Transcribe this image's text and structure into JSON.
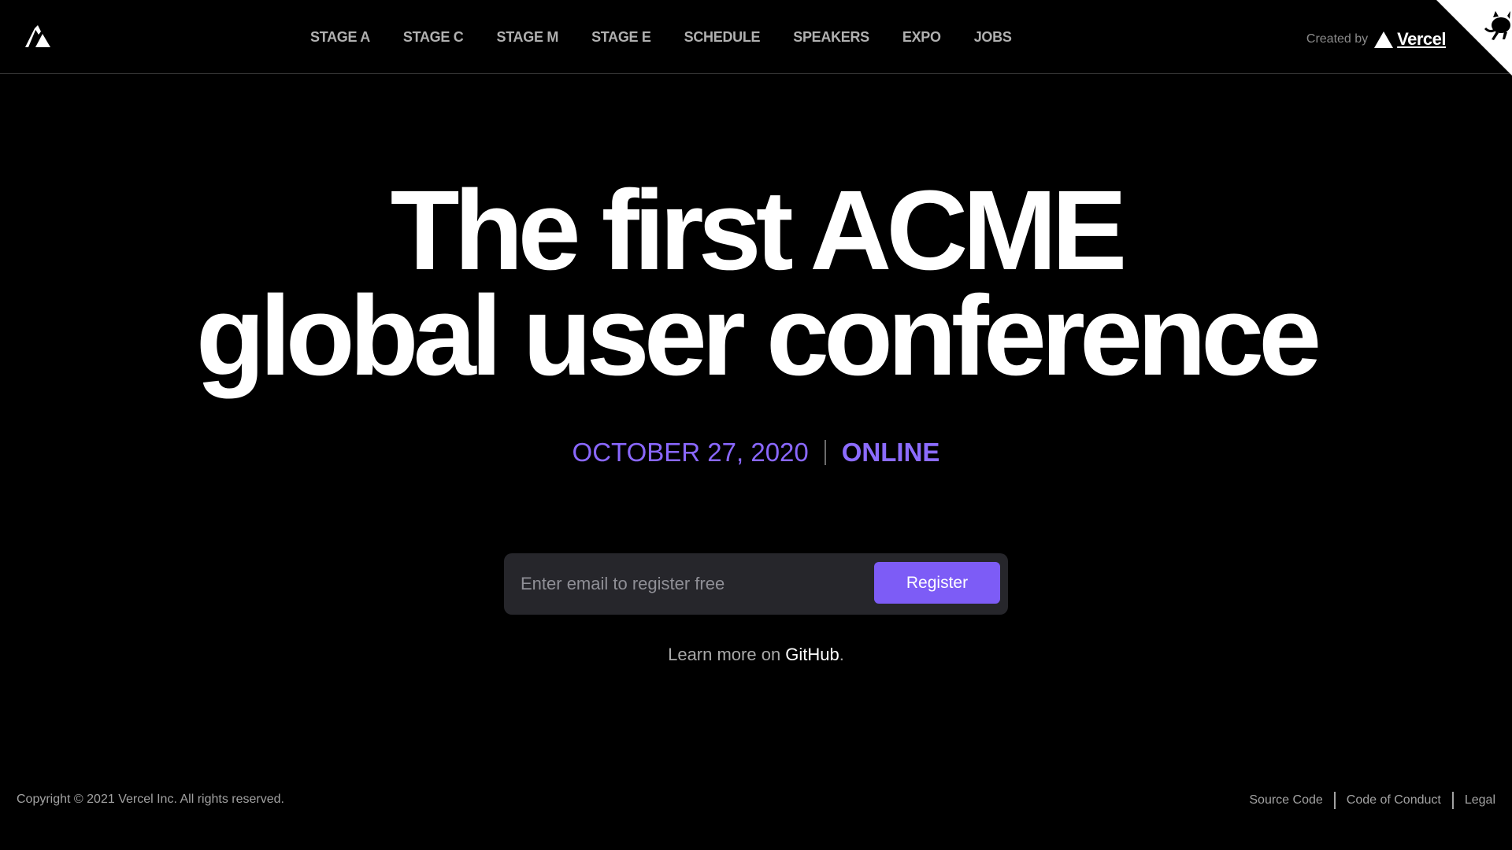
{
  "header": {
    "nav": [
      {
        "label": "STAGE A"
      },
      {
        "label": "STAGE C"
      },
      {
        "label": "STAGE M"
      },
      {
        "label": "STAGE E"
      },
      {
        "label": "SCHEDULE"
      },
      {
        "label": "SPEAKERS"
      },
      {
        "label": "EXPO"
      },
      {
        "label": "JOBS"
      }
    ],
    "created_by": "Created by",
    "vercel_name": "Vercel"
  },
  "hero": {
    "title_line1": "The first ACME",
    "title_line2": "global user conference",
    "date": "OCTOBER 27, 2020",
    "location": "ONLINE"
  },
  "form": {
    "email_placeholder": "Enter email to register free",
    "email_value": "",
    "register_label": "Register"
  },
  "learn": {
    "prefix": "Learn more on ",
    "link": "GitHub",
    "suffix": "."
  },
  "footer": {
    "copyright": "Copyright © 2021 Vercel Inc. All rights reserved.",
    "links": [
      {
        "label": "Source Code"
      },
      {
        "label": "Code of Conduct"
      },
      {
        "label": "Legal"
      }
    ]
  },
  "colors": {
    "accent": "#7d5cf6",
    "date_text": "#8a68ff",
    "background": "#000000",
    "input_bg": "#26262b"
  },
  "icons": {
    "logo": "acme-logo-icon",
    "vercel": "vercel-triangle-icon",
    "corner": "github-octocat-icon"
  }
}
